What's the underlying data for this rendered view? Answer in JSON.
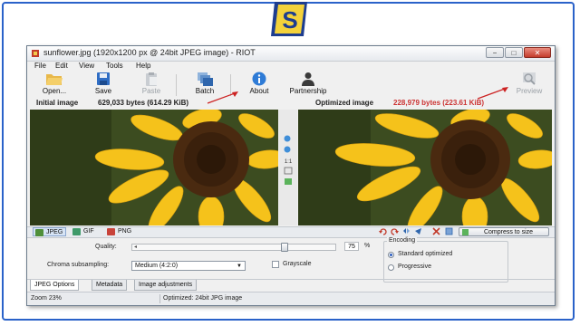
{
  "window": {
    "title": "sunflower.jpg (1920x1200 px @ 24bit JPEG image) - RIOT",
    "controls": {
      "minimize": "−",
      "maximize": "□",
      "close": "✕"
    }
  },
  "menu": [
    "File",
    "Edit",
    "View",
    "Tools",
    "Help"
  ],
  "toolbar": {
    "open": "Open...",
    "save": "Save",
    "paste": "Paste",
    "batch": "Batch",
    "about": "About",
    "partnership": "Partnership",
    "preview": "Preview"
  },
  "info": {
    "initial_label": "Initial image",
    "initial_size": "629,033 bytes (614.29 KiB)",
    "optimized_label": "Optimized image",
    "optimized_size": "228,979 bytes (223.61 KiB)"
  },
  "format_tabs": [
    "JPEG",
    "GIF",
    "PNG"
  ],
  "compress_label": "Compress to size",
  "settings": {
    "quality_label": "Quality:",
    "quality_value": "75",
    "quality_unit": "%",
    "quality_fraction": 0.75,
    "chroma_label": "Chroma subsampling:",
    "chroma_value": "Medium (4:2:0)",
    "grayscale_label": "Grayscale",
    "encoding_title": "Encoding",
    "encoding_options": [
      "Standard optimized",
      "Progressive"
    ]
  },
  "bottom_tabs": [
    "JPEG Options",
    "Metadata",
    "Image adjustments"
  ],
  "status": {
    "zoom": "Zoom 23%",
    "optimized": "Optimized: 24bit JPG image"
  },
  "colors": {
    "accent": "#2a62c9",
    "size_value": "#cc3333",
    "petal": "#f5c21b",
    "disk": "#4a2a10"
  }
}
